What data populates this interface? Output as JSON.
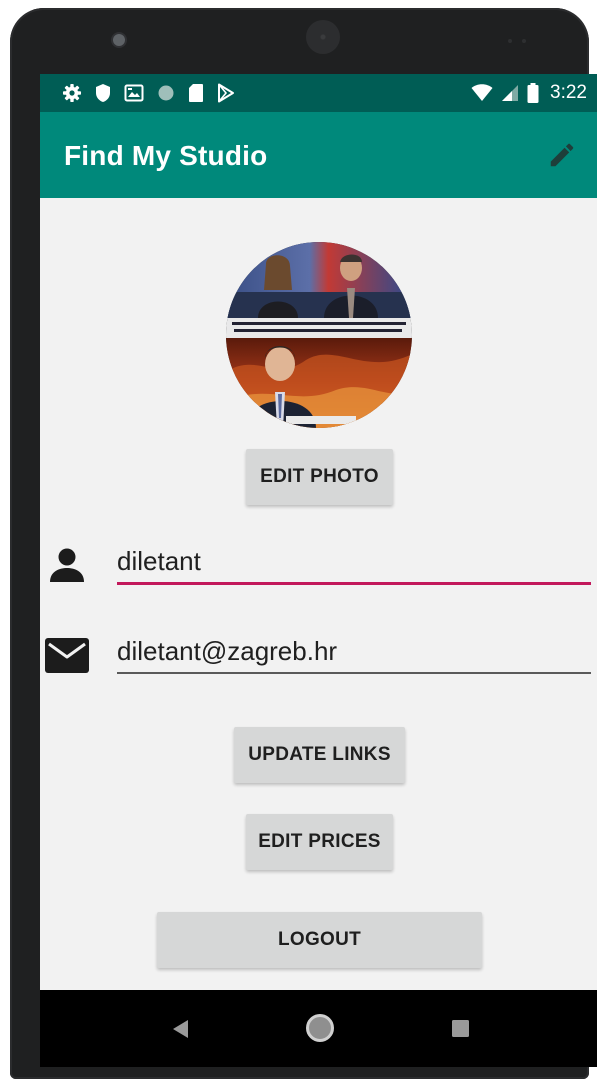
{
  "status_bar": {
    "time": "3:22",
    "left_icons": [
      "gear-icon",
      "shield-icon",
      "image-icon",
      "circle-icon",
      "sd-card-icon",
      "play-store-icon"
    ],
    "right_icons": [
      "wifi-icon",
      "signal-icon",
      "battery-icon"
    ]
  },
  "app_bar": {
    "title": "Find My Studio",
    "action_icon": "pencil-icon"
  },
  "profile": {
    "edit_photo_label": "EDIT PHOTO",
    "username_value": "diletant",
    "email_value": "diletant@zagreb.hr",
    "update_links_label": "UPDATE LINKS",
    "edit_prices_label": "EDIT PRICES",
    "logout_label": "LOGOUT"
  },
  "colors": {
    "status_bar": "#005d55",
    "app_bar": "#00897b",
    "focused_underline": "#c2185b",
    "screen_background": "#f2f2f2"
  },
  "nav_bar": {
    "icons": [
      "back-icon",
      "home-icon",
      "recents-icon"
    ]
  }
}
